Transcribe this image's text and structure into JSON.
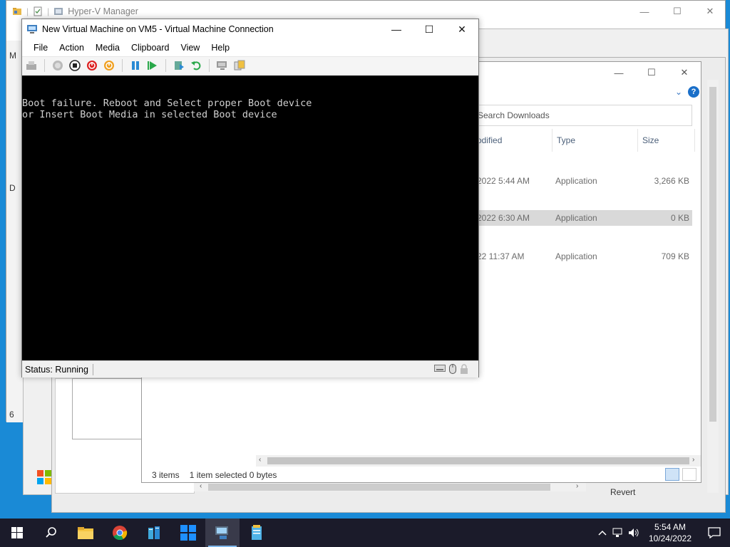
{
  "hyperv": {
    "title": "Hyper-V Manager",
    "left_strip": [
      "M",
      "D",
      "6"
    ],
    "minimize": "—",
    "maximize": "☐",
    "close": "✕"
  },
  "explorer": {
    "search_placeholder": "Search Downloads",
    "columns": [
      "odified",
      "Type",
      "Size"
    ],
    "files": [
      {
        "modified": "2022 5:44 AM",
        "type": "Application",
        "size": "3,266 KB",
        "selected": false
      },
      {
        "modified": "2022 6:30 AM",
        "type": "Application",
        "size": "0 KB",
        "selected": true
      },
      {
        "modified": "22 11:37 AM",
        "type": "Application",
        "size": "709 KB",
        "selected": false
      }
    ],
    "status_items": "3 items",
    "status_selected": "1 item selected  0 bytes",
    "minimize": "—",
    "maximize": "☐",
    "close": "✕",
    "help": "?"
  },
  "revert_label": "Revert",
  "vm": {
    "title": "New Virtual Machine on VM5 - Virtual Machine Connection",
    "menu": [
      "File",
      "Action",
      "Media",
      "Clipboard",
      "View",
      "Help"
    ],
    "screen_text": "Boot failure. Reboot and Select proper Boot device\nor Insert Boot Media in selected Boot device",
    "status": "Status: Running",
    "minimize": "—",
    "maximize": "☐",
    "close": "✕"
  },
  "taskbar": {
    "time": "5:54 AM",
    "date": "10/24/2022"
  },
  "colors": {
    "desktop": "#1a8ad6",
    "taskbar": "#1b1b2a",
    "vm_screen": "#000000",
    "accent": "#1a6fc9"
  }
}
